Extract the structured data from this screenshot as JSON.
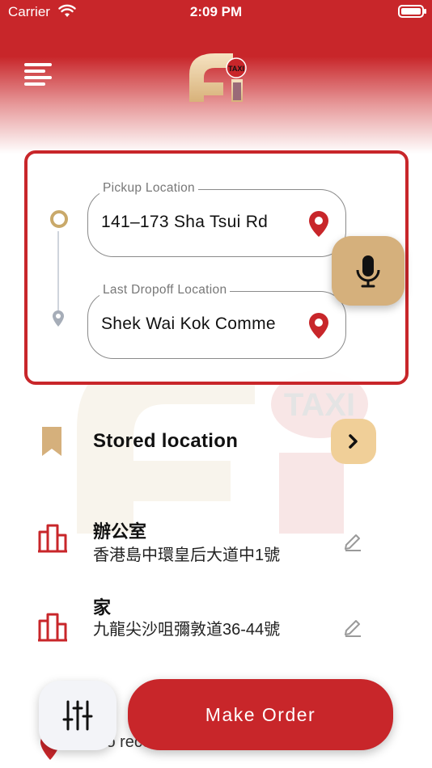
{
  "status_bar": {
    "carrier": "Carrier",
    "time": "2:09 PM"
  },
  "header": {
    "logo_badge": "TAXI"
  },
  "trip": {
    "pickup": {
      "label": "Pickup Location",
      "value": "141–173 Sha Tsui Rd"
    },
    "dropoff": {
      "label": "Last Dropoff Location",
      "value": "Shek Wai Kok Comme"
    }
  },
  "watermark": {
    "text": "TAXI"
  },
  "stored": {
    "label": "Stored location"
  },
  "saved_locations": [
    {
      "name": "辦公室",
      "address": "香港島中環皇后大道中1號"
    },
    {
      "name": "家",
      "address": "九龍尖沙咀彌敦道36-44號"
    }
  ],
  "recent": {
    "text": "No recently"
  },
  "actions": {
    "make_order": "Make Order"
  },
  "colors": {
    "brand_red": "#c8262a",
    "gold": "#d5b07c",
    "light_gold": "#f0cf98"
  },
  "icons": [
    "menu-icon",
    "wifi-icon",
    "battery-icon",
    "map-pin-icon",
    "microphone-icon",
    "bookmark-icon",
    "chevron-right-icon",
    "building-icon",
    "pencil-icon",
    "sliders-icon"
  ]
}
